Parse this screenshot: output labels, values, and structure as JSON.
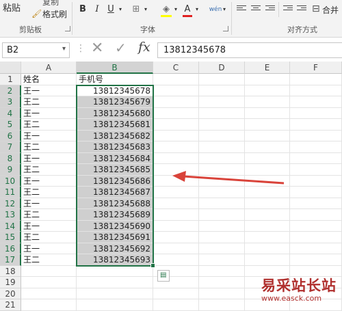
{
  "ribbon": {
    "paste_label": "粘贴",
    "copy_label": "复制",
    "format_painter_label": "格式刷",
    "groups": {
      "clipboard": "剪贴板",
      "font": "字体",
      "alignment": "对齐方式"
    },
    "bold": "B",
    "italic": "I",
    "underline": "U",
    "phonetic": "wén",
    "merge_label": "合并"
  },
  "formula_bar": {
    "name_box": "B2",
    "value": "13812345678"
  },
  "columns": [
    "A",
    "B",
    "C",
    "D",
    "E",
    "F"
  ],
  "rows": [
    "1",
    "2",
    "3",
    "4",
    "5",
    "6",
    "7",
    "8",
    "9",
    "10",
    "11",
    "12",
    "13",
    "14",
    "15",
    "16",
    "17",
    "18",
    "19",
    "20",
    "21"
  ],
  "cells": {
    "A": [
      "姓名",
      "王一",
      "王二",
      "王一",
      "王二",
      "王一",
      "王二",
      "王一",
      "王二",
      "王一",
      "王二",
      "王一",
      "王二",
      "王一",
      "王二",
      "王一",
      "王二"
    ],
    "B": [
      "手机号",
      "13812345678",
      "13812345679",
      "13812345680",
      "13812345681",
      "13812345682",
      "13812345683",
      "13812345684",
      "13812345685",
      "13812345686",
      "13812345687",
      "13812345688",
      "13812345689",
      "13812345690",
      "13812345691",
      "13812345692",
      "13812345693"
    ]
  },
  "selection": {
    "active_cell": "B2",
    "range": "B2:B17"
  },
  "accent_colors": {
    "excel_green": "#217346",
    "highlight_yellow": "#ffff00",
    "font_red": "#e02020",
    "arrow_red": "#d9433a"
  },
  "watermark": {
    "text": "易采站长站",
    "sub": "www.easck.com"
  }
}
